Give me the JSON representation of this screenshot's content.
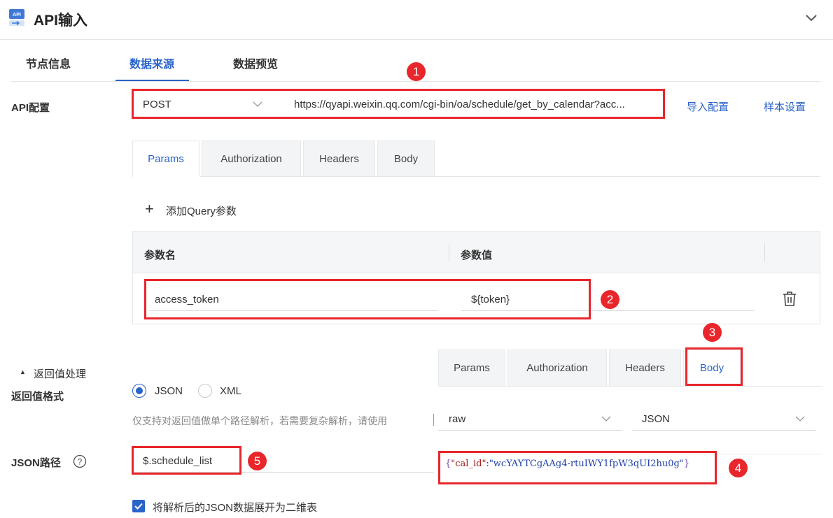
{
  "header": {
    "title": "API输入"
  },
  "tabs": [
    {
      "label": "节点信息",
      "active": false
    },
    {
      "label": "数据来源",
      "active": true
    },
    {
      "label": "数据预览",
      "active": false
    }
  ],
  "api_config": {
    "label": "API配置",
    "method": "POST",
    "url": "https://qyapi.weixin.qq.com/cgi-bin/oa/schedule/get_by_calendar?acc...",
    "import_label": "导入配置",
    "sample_label": "样本设置"
  },
  "sub_tabs": [
    "Params",
    "Authorization",
    "Headers",
    "Body"
  ],
  "params": {
    "add_label": "添加Query参数",
    "col_name": "参数名",
    "col_value": "参数值",
    "rows": [
      {
        "name": "access_token",
        "value": "${token}"
      }
    ]
  },
  "return_section": {
    "toggle_label": "返回值处理",
    "format_label": "返回值格式",
    "options": [
      "JSON",
      "XML"
    ],
    "selected": "JSON",
    "hint": "仅支持对返回值做单个路径解析，若需要复杂解析，请使用",
    "json_path_label": "JSON路径",
    "json_path_value": "$.schedule_list",
    "expand_label": "将解析后的JSON数据展开为二维表",
    "expand_checked": true
  },
  "body_panel": {
    "tabs": [
      "Params",
      "Authorization",
      "Headers",
      "Body"
    ],
    "active": "Body",
    "raw_select": "raw",
    "type_select": "JSON",
    "body_key": "cal_id",
    "body_value": "wcYAYTCgAAg4-rtuIWY1fpW3qUI2hu0g"
  },
  "badges": [
    "1",
    "2",
    "3",
    "4",
    "5"
  ],
  "colors": {
    "accent": "#2a63c9",
    "annotation": "#e8262b"
  }
}
